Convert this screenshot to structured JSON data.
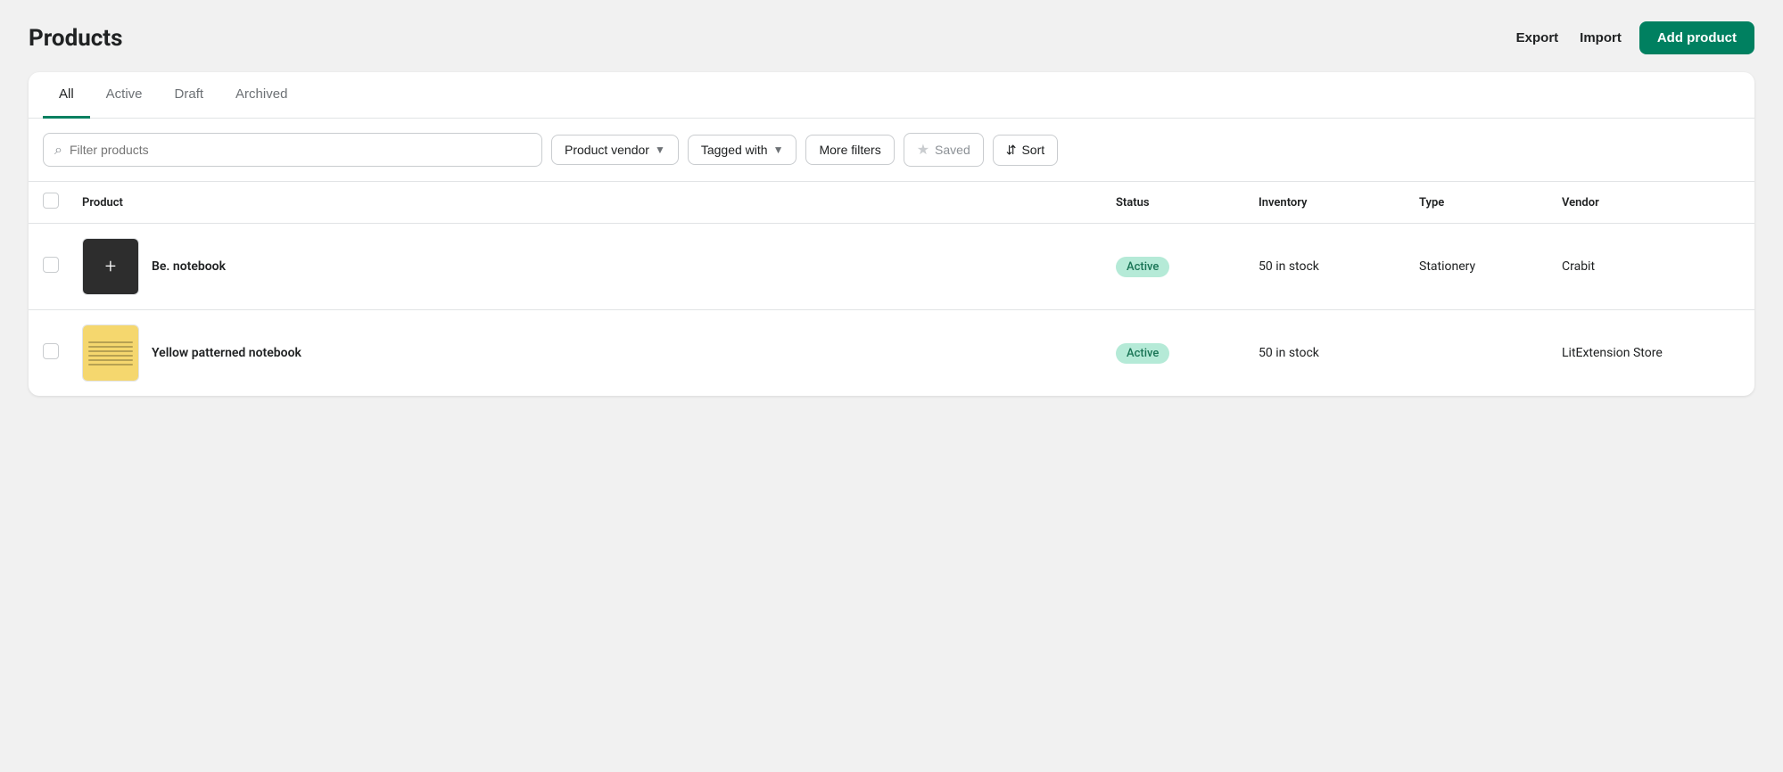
{
  "page": {
    "title": "Products"
  },
  "header": {
    "export_label": "Export",
    "import_label": "Import",
    "add_product_label": "Add product"
  },
  "tabs": [
    {
      "id": "all",
      "label": "All",
      "active": true
    },
    {
      "id": "active",
      "label": "Active",
      "active": false
    },
    {
      "id": "draft",
      "label": "Draft",
      "active": false
    },
    {
      "id": "archived",
      "label": "Archived",
      "active": false
    }
  ],
  "filters": {
    "search_placeholder": "Filter products",
    "product_vendor_label": "Product vendor",
    "tagged_with_label": "Tagged with",
    "more_filters_label": "More filters",
    "saved_label": "Saved",
    "sort_label": "Sort"
  },
  "table": {
    "headers": {
      "product": "Product",
      "status": "Status",
      "inventory": "Inventory",
      "type": "Type",
      "vendor": "Vendor"
    },
    "rows": [
      {
        "id": 1,
        "name": "Be. notebook",
        "status": "Active",
        "inventory": "50 in stock",
        "type": "Stationery",
        "vendor": "Crabit",
        "thumb_type": "black"
      },
      {
        "id": 2,
        "name": "Yellow patterned notebook",
        "status": "Active",
        "inventory": "50 in stock",
        "type": "",
        "vendor": "LitExtension Store",
        "thumb_type": "yellow"
      }
    ]
  }
}
